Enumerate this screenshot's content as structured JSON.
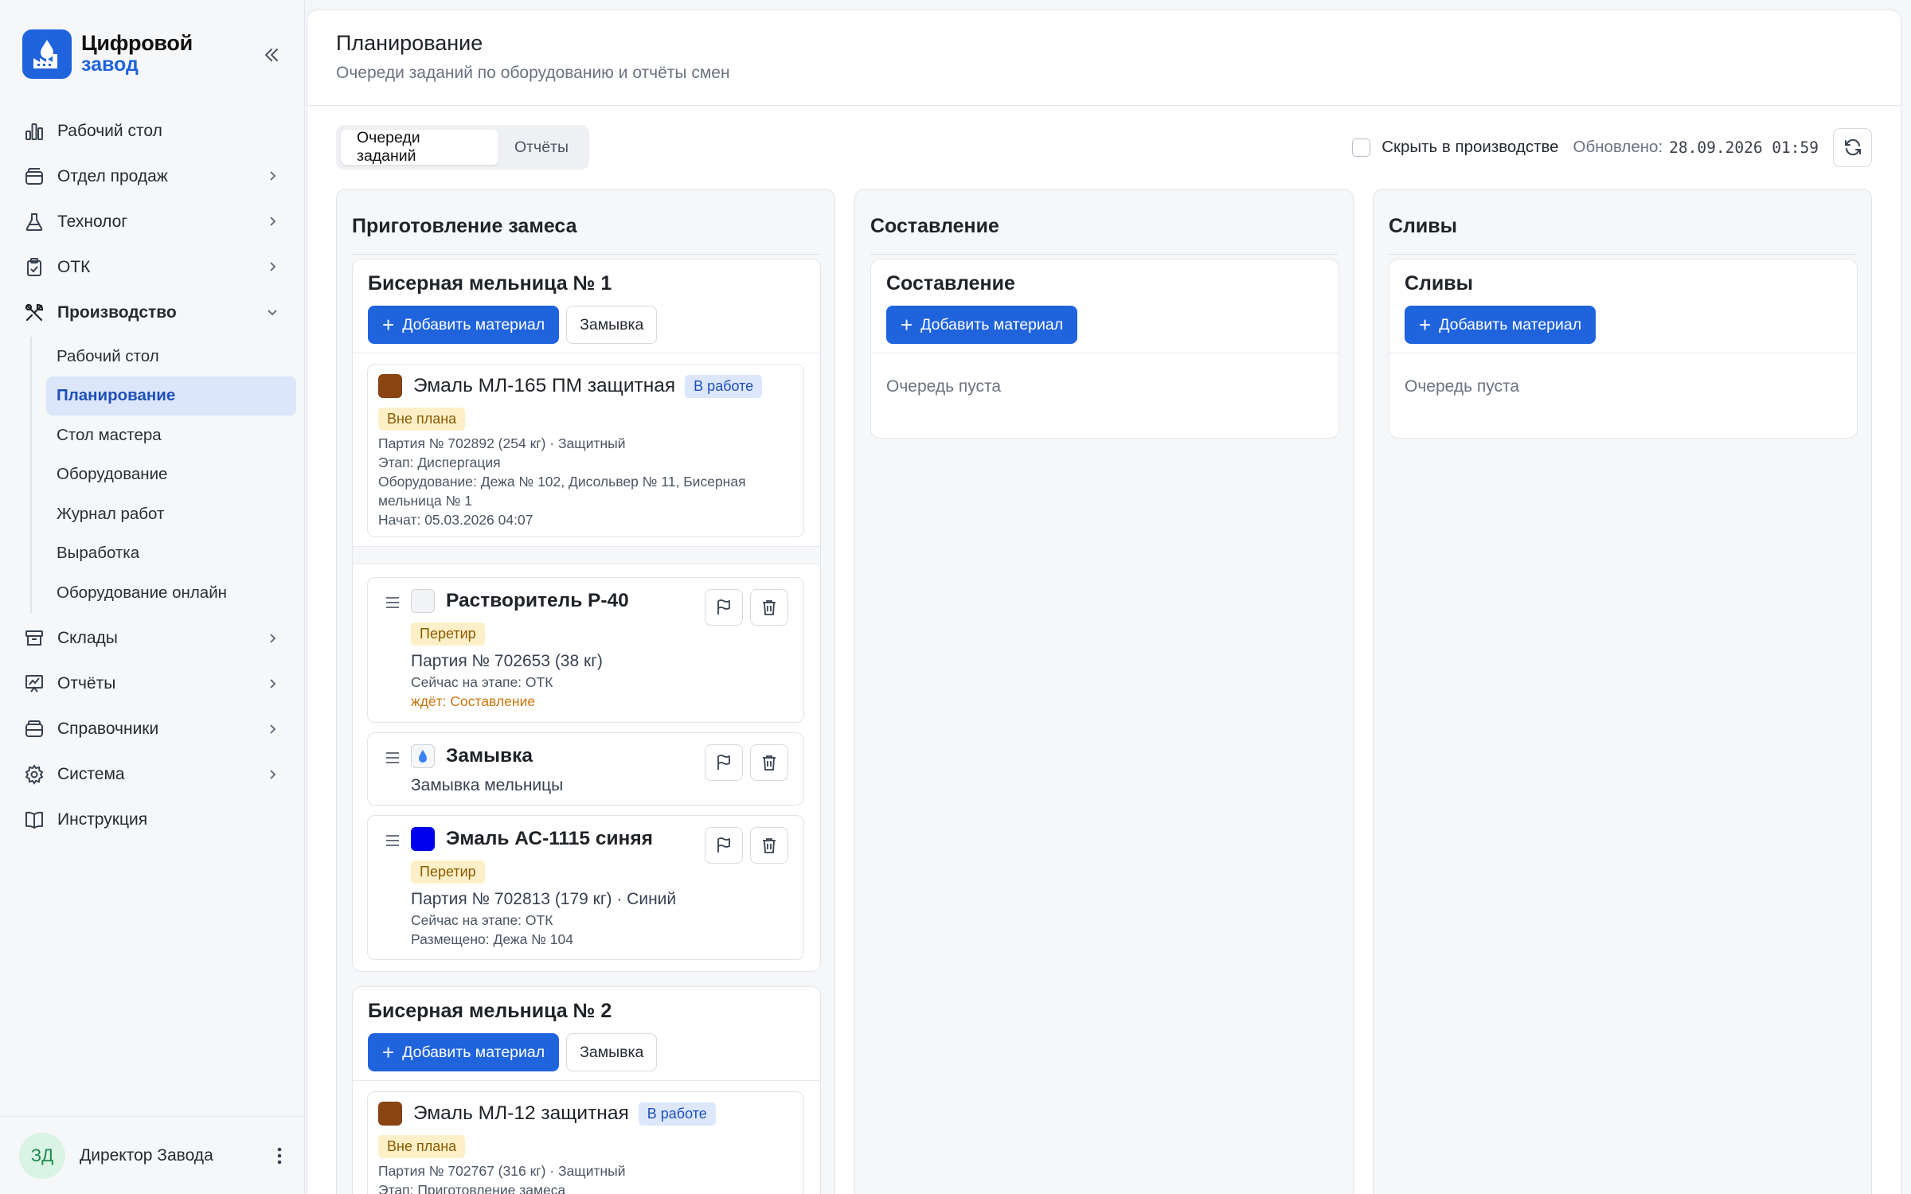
{
  "app": {
    "logo_line1": "Цифровой",
    "logo_line2": "завод",
    "accent": "#1f63dd"
  },
  "sidebar": {
    "items": [
      {
        "label": "Рабочий стол",
        "icon": "bar-chart-icon"
      },
      {
        "label": "Отдел продаж",
        "icon": "wallet-icon"
      },
      {
        "label": "Технолог",
        "icon": "flask-icon"
      },
      {
        "label": "ОТК",
        "icon": "clipboard-check-icon"
      },
      {
        "label": "Производство",
        "icon": "tools-icon"
      },
      {
        "label": "Склады",
        "icon": "archive-icon"
      },
      {
        "label": "Отчёты",
        "icon": "presentation-chart-icon"
      },
      {
        "label": "Справочники",
        "icon": "database-icon"
      },
      {
        "label": "Система",
        "icon": "gear-icon"
      },
      {
        "label": "Инструкция",
        "icon": "book-icon"
      }
    ],
    "sub_items": [
      "Рабочий стол",
      "Планирование",
      "Стол мастера",
      "Оборудование",
      "Журнал работ",
      "Выработка",
      "Оборудование онлайн"
    ],
    "active_sub": "Планирование",
    "user": {
      "initials": "ЗД",
      "name": "Директор Завода"
    }
  },
  "page": {
    "title": "Планирование",
    "subtitle": "Очереди заданий по оборудованию и отчёты смен"
  },
  "toolbar": {
    "tabs": [
      "Очереди заданий",
      "Отчёты"
    ],
    "active_tab": "Очереди заданий",
    "hide_label": "Скрыть в производстве",
    "hide_checked": false,
    "updated_label": "Обновлено:",
    "updated_value": "28.09.2026 01:59"
  },
  "columns": [
    {
      "title": "Приготовление замеса",
      "equipment": [
        {
          "name": "Бисерная мельница № 1",
          "add_label": "Добавить материал",
          "mill_label": "Замывка",
          "current": {
            "name": "Эмаль МЛ-165 ПМ защитная",
            "color": "#8b4513",
            "status": "В работе",
            "plan_badge": "Вне плана",
            "batch": "Партия № 702892 (254 кг) · Защитный",
            "stage": "Этап: Диспергация",
            "equipment": "Оборудование: Дежа № 102, Дисольвер № 11, Бисерная мельница № 1",
            "started": "Начат: 05.03.2026 04:07"
          },
          "queue": [
            {
              "name": "Растворитель Р-40",
              "color": "#f3f4f6",
              "badge": "Перетир",
              "batch": "Партия № 702653 (38 кг)",
              "stage_now": "Сейчас на этапе: ОТК",
              "waiting": "ждёт: Составление"
            },
            {
              "name": "Замывка",
              "icon": "water-drop-icon",
              "description": "Замывка мельницы"
            },
            {
              "name": "Эмаль АС-1115 синяя",
              "color": "#0000ee",
              "badge": "Перетир",
              "batch": "Партия № 702813 (179 кг) · Синий",
              "stage_now": "Сейчас на этапе: ОТК",
              "placed": "Размещено: Дежа № 104"
            }
          ]
        },
        {
          "name": "Бисерная мельница № 2",
          "add_label": "Добавить материал",
          "mill_label": "Замывка",
          "current": {
            "name": "Эмаль МЛ-12 защитная",
            "color": "#8b4513",
            "status": "В работе",
            "plan_badge": "Вне плана",
            "batch": "Партия № 702767 (316 кг) · Защитный",
            "stage": "Этап: Приготовление замеса"
          }
        }
      ]
    },
    {
      "title": "Составление",
      "equipment": [
        {
          "name": "Составление",
          "add_label": "Добавить материал",
          "empty": "Очередь пуста"
        }
      ]
    },
    {
      "title": "Сливы",
      "equipment": [
        {
          "name": "Сливы",
          "add_label": "Добавить материал",
          "empty": "Очередь пуста"
        }
      ]
    }
  ]
}
